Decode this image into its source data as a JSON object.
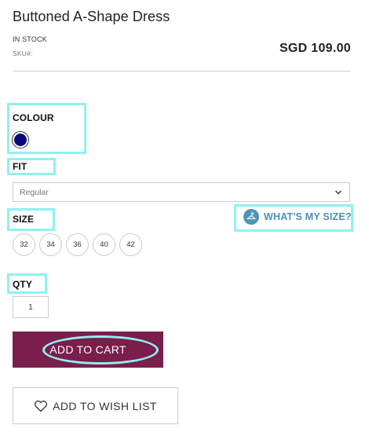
{
  "product": {
    "title": "Buttoned A-Shape Dress",
    "stock_status": "IN STOCK",
    "sku_label": "SKU#:",
    "price": "SGD 109.00"
  },
  "colour": {
    "label": "COLOUR",
    "swatches": [
      {
        "icon": "navy-colour-swatch",
        "color": "#0a0a7a"
      }
    ]
  },
  "fit": {
    "label": "FIT",
    "selected": "Regular",
    "icon": "chevron-down-icon"
  },
  "size": {
    "label": "SIZE",
    "options": [
      "32",
      "34",
      "36",
      "40",
      "42"
    ],
    "whats_my_size": "WHAT'S MY SIZE?",
    "whats_my_size_icon": "hanger-icon"
  },
  "qty": {
    "label": "QTY",
    "value": "1"
  },
  "actions": {
    "add_to_cart": "ADD TO CART",
    "add_to_wishlist": "ADD TO WISH LIST",
    "wishlist_icon": "heart-icon"
  },
  "colors": {
    "brand": "#7a1e4c",
    "highlight": "#8ff0f3",
    "link": "#4a8fb6"
  }
}
